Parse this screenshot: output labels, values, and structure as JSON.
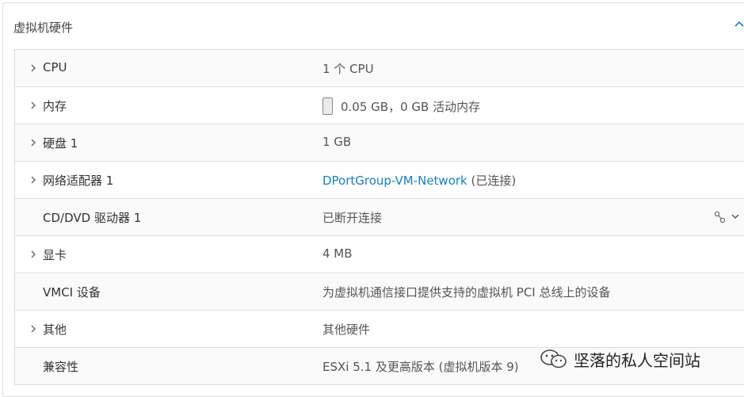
{
  "panel": {
    "title": "虚拟机硬件",
    "collapse_icon": "chevron-up-icon"
  },
  "rows": [
    {
      "label": "CPU",
      "value": "1 个 CPU",
      "expandable": true
    },
    {
      "label": "内存",
      "value": "0.05 GB，0 GB 活动内存",
      "expandable": true,
      "icon": "memory-icon"
    },
    {
      "label": "硬盘 1",
      "value": "1 GB",
      "expandable": true
    },
    {
      "label": "网络适配器 1",
      "value_link": "DPortGroup-VM-Network",
      "value_suffix": " (已连接)",
      "expandable": true
    },
    {
      "label": "CD/DVD 驱动器 1",
      "value": "已断开连接",
      "expandable": false,
      "actions_icon": "connect-icon"
    },
    {
      "label": "显卡",
      "value": "4 MB",
      "expandable": true
    },
    {
      "label": "VMCI 设备",
      "value": "为虚拟机通信接口提供支持的虚拟机 PCI 总线上的设备",
      "expandable": false
    },
    {
      "label": "其他",
      "value": "其他硬件",
      "expandable": true
    },
    {
      "label": "兼容性",
      "value": "ESXi 5.1 及更高版本 (虚拟机版本 9)",
      "expandable": false
    }
  ],
  "watermark": {
    "text": "坚落的私人空间站",
    "icon": "wechat-icon"
  },
  "colors": {
    "link": "#1a7fb5",
    "border": "#d8d8d8",
    "row_alt": "#fafafa"
  }
}
